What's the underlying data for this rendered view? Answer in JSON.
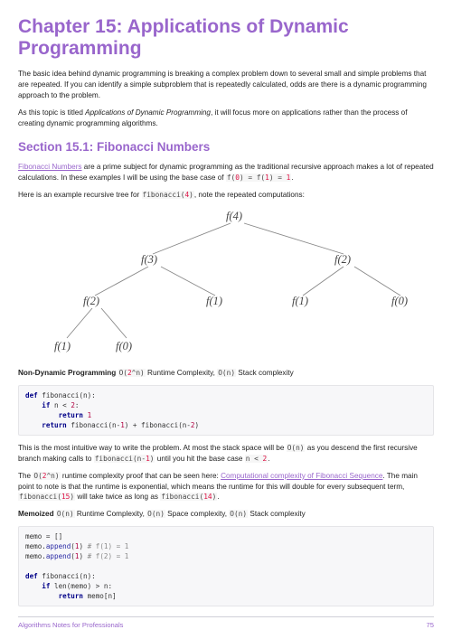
{
  "chapter_title": "Chapter 15: Applications of Dynamic Programming",
  "intro_p1": "The basic idea behind dynamic programming is breaking a complex problem down to several small and simple problems that are repeated. If you can identify a simple subproblem that is repeatedly calculated, odds are there is a dynamic programming approach to the problem.",
  "intro_p2a": "As this topic is titled ",
  "intro_p2_em": "Applications of Dynamic Programming",
  "intro_p2b": ", it will focus more on applications rather than the process of creating dynamic programming algorithms.",
  "section_title": "Section 15.1: Fibonacci Numbers",
  "fib_link": "Fibonacci Numbers",
  "p3a": " are a prime subject for dynamic programming as the traditional recursive approach makes a lot of repeated calculations. In these examples I will be using the base case of ",
  "p3_code": "f(0) = f(1) = 1",
  "p3b": ".",
  "p4a": "Here is an example recursive tree for ",
  "p4_code": "fibonacci(4)",
  "p4b": ", note the repeated computations:",
  "tree": {
    "nodes": [
      "f(4)",
      "f(3)",
      "f(2)",
      "f(2)",
      "f(1)",
      "f(1)",
      "f(0)",
      "f(1)",
      "f(0)"
    ]
  },
  "nondp_label": "Non-Dynamic Programming ",
  "nondp_code1": "O(2^n)",
  "nondp_mid": " Runtime Complexity, ",
  "nondp_code2": "O(n)",
  "nondp_end": " Stack complexity",
  "code1_lines": [
    {
      "segs": [
        {
          "t": "def ",
          "c": "kw"
        },
        {
          "t": "fibonacci(n):"
        }
      ]
    },
    {
      "segs": [
        {
          "t": "    "
        },
        {
          "t": "if ",
          "c": "kw"
        },
        {
          "t": "n < "
        },
        {
          "t": "2",
          "c": "num"
        },
        {
          "t": ":"
        }
      ]
    },
    {
      "segs": [
        {
          "t": "        "
        },
        {
          "t": "return ",
          "c": "kw"
        },
        {
          "t": "1",
          "c": "num"
        }
      ]
    },
    {
      "segs": [
        {
          "t": "    "
        },
        {
          "t": "return ",
          "c": "kw"
        },
        {
          "t": "fibonacci(n-"
        },
        {
          "t": "1",
          "c": "num"
        },
        {
          "t": ") + fibonacci(n-"
        },
        {
          "t": "2",
          "c": "num"
        },
        {
          "t": ")"
        }
      ]
    }
  ],
  "p5a": "This is the most intuitive way to write the problem. At most the stack space will be ",
  "p5_code1": "O(n)",
  "p5b": " as you descend the first recursive branch making calls to ",
  "p5_code2": "fibonacci(n-1)",
  "p5c": " until you hit the base case ",
  "p5_code3": "n < 2",
  "p5d": ".",
  "p6a": "The ",
  "p6_code1": "O(2^n)",
  "p6b": " runtime complexity proof that can be seen here: ",
  "p6_link": "Computational complexity of Fibonacci Sequence",
  "p6c": ". The main point to note is that the runtime is exponential, which means the runtime for this will double for every subsequent term, ",
  "p6_code2": "fibonacci(15)",
  "p6d": " will take twice as long as ",
  "p6_code3": "fibonacci(14)",
  "p6e": ".",
  "memo_label": "Memoized ",
  "memo_code1": "O(n)",
  "memo_mid1": " Runtime Complexity, ",
  "memo_code2": "O(n)",
  "memo_mid2": " Space complexity, ",
  "memo_code3": "O(n)",
  "memo_end": " Stack complexity",
  "code2_lines": [
    {
      "segs": [
        {
          "t": "memo = []"
        }
      ]
    },
    {
      "segs": [
        {
          "t": "memo."
        },
        {
          "t": "append",
          "c": "fn"
        },
        {
          "t": "("
        },
        {
          "t": "1",
          "c": "num"
        },
        {
          "t": ") "
        },
        {
          "t": "# f(1) = 1",
          "c": "cm"
        }
      ]
    },
    {
      "segs": [
        {
          "t": "memo."
        },
        {
          "t": "append",
          "c": "fn"
        },
        {
          "t": "("
        },
        {
          "t": "1",
          "c": "num"
        },
        {
          "t": ") "
        },
        {
          "t": "# f(2) = 1",
          "c": "cm"
        }
      ]
    },
    {
      "segs": [
        {
          "t": ""
        }
      ]
    },
    {
      "segs": [
        {
          "t": "def ",
          "c": "kw"
        },
        {
          "t": "fibonacci(n):"
        }
      ]
    },
    {
      "segs": [
        {
          "t": "    "
        },
        {
          "t": "if ",
          "c": "kw"
        },
        {
          "t": "len(memo) > n:"
        }
      ]
    },
    {
      "segs": [
        {
          "t": "        "
        },
        {
          "t": "return ",
          "c": "kw"
        },
        {
          "t": "memo[n]"
        }
      ]
    }
  ],
  "footer_left": "Algorithms Notes for Professionals",
  "footer_right": "75"
}
